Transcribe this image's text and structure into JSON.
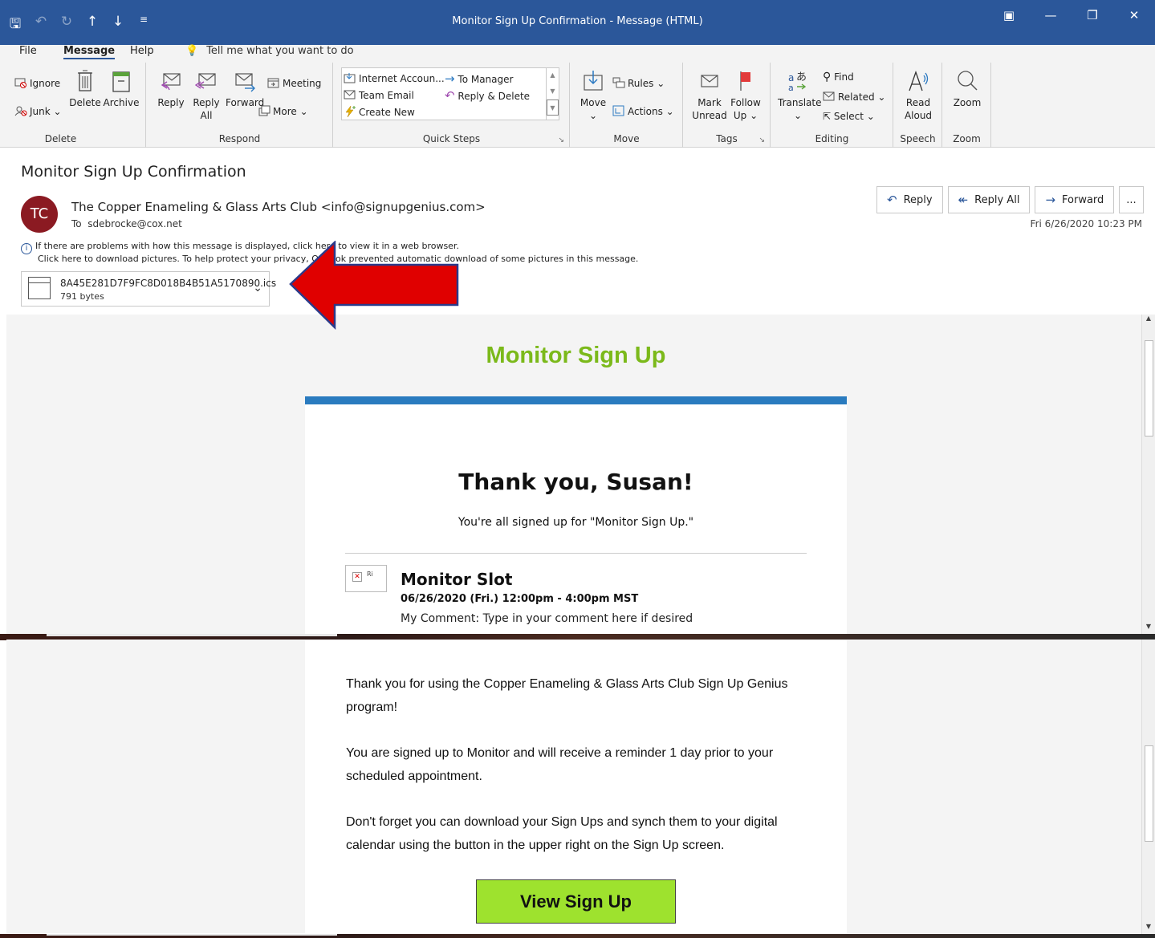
{
  "window": {
    "title": "Monitor Sign Up Confirmation  -  Message (HTML)",
    "qat": [
      "save-icon",
      "undo-icon",
      "redo-icon",
      "up-icon",
      "down-icon",
      "customize-icon"
    ]
  },
  "menu": {
    "tabs": [
      "File",
      "Message",
      "Help"
    ],
    "active": "Message",
    "tell_me": "Tell me what you want to do"
  },
  "ribbon": {
    "delete": {
      "label": "Delete",
      "ignore": "Ignore",
      "junk": "Junk",
      "delete": "Delete",
      "archive": "Archive"
    },
    "respond": {
      "label": "Respond",
      "reply": "Reply",
      "reply_all_1": "Reply",
      "reply_all_2": "All",
      "forward": "Forward",
      "meeting": "Meeting",
      "more": "More"
    },
    "quick_steps": {
      "label": "Quick Steps",
      "items": [
        "Internet Accoun...",
        "Team Email",
        "Create New",
        "To Manager",
        "Reply & Delete"
      ]
    },
    "move": {
      "label": "Move",
      "move": "Move",
      "rules": "Rules",
      "actions": "Actions"
    },
    "tags": {
      "label": "Tags",
      "mark_1": "Mark",
      "mark_2": "Unread",
      "follow_1": "Follow",
      "follow_2": "Up"
    },
    "editing": {
      "label": "Editing",
      "translate": "Translate",
      "find": "Find",
      "related": "Related",
      "select": "Select"
    },
    "speech": {
      "label": "Speech",
      "read_1": "Read",
      "read_2": "Aloud"
    },
    "zoom": {
      "label": "Zoom",
      "zoom": "Zoom"
    }
  },
  "message": {
    "subject": "Monitor Sign Up Confirmation",
    "avatar_initials": "TC",
    "sender": "The Copper Enameling & Glass Arts Club <info@signupgenius.com>",
    "to_label": "To",
    "to": "sdebrocke@cox.net",
    "info_line_1": "If there are problems with how this message is displayed, click here to view it in a web browser.",
    "info_line_2": "Click here to download pictures. To help protect your privacy, Outlook prevented automatic download of some pictures in this message.",
    "datetime": "Fri 6/26/2020 10:23 PM",
    "actions": {
      "reply": "Reply",
      "reply_all": "Reply All",
      "forward": "Forward",
      "more": "..."
    },
    "attachment": {
      "filename": "8A45E281D7F9FC8D018B4B51A5170890.ics",
      "size": "791 bytes"
    }
  },
  "email_body": {
    "header_title": "Monitor Sign Up",
    "thanks": "Thank you, Susan!",
    "signed_up": "You're all signed up for \"Monitor Sign Up.\"",
    "slot_image_alt": "Ri",
    "slot_title": "Monitor Slot",
    "slot_when": "06/26/2020 (Fri.) 12:00pm - 4:00pm MST",
    "slot_comment": "My Comment: Type in your comment here if desired",
    "para_1": "Thank you for using the Copper Enameling & Glass Arts Club Sign Up Genius program!",
    "para_2": "You are signed up to Monitor and will receive a reminder 1 day prior to your scheduled appointment.",
    "para_3": "Don't forget you can download your Sign Ups and synch them to your digital calendar using the button in the upper right on the Sign Up screen.",
    "button": "View Sign Up"
  },
  "colors": {
    "title_bar": "#2b579a",
    "header_green": "#7bb91a",
    "accent_blue": "#2a7bbf",
    "button_green": "#9ee22e",
    "avatar": "#8b1a22",
    "annotation_arrow": "#e00000"
  }
}
